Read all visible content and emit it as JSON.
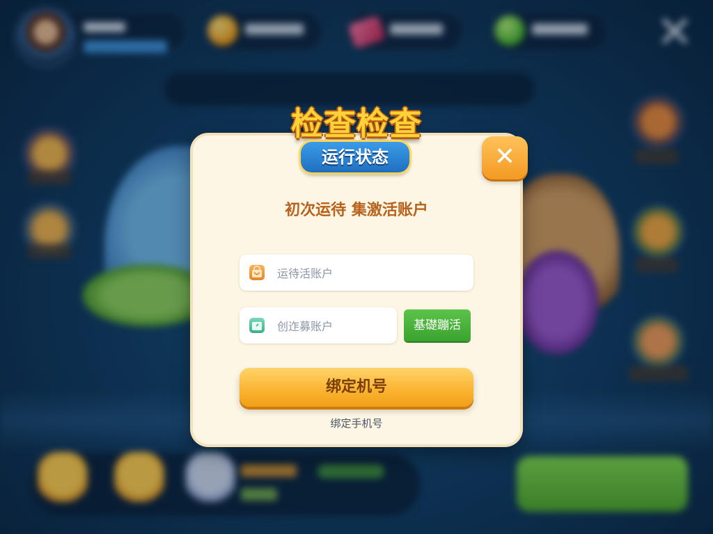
{
  "colors": {
    "primary_button": "#fbb534",
    "activate_button": "#3aa32e",
    "dialog_bg": "#fdf6e4",
    "subtitle_text": "#b8611a",
    "title_gold": "#ffd23a",
    "badge_blue": "#1f6fc0"
  },
  "dialog": {
    "title": "检查检查",
    "badge": "运行状态",
    "close_icon": "✕",
    "subtitle": "初次运待 集激活账户",
    "account_field": {
      "icon": "bag-icon",
      "placeholder": "运待活账户",
      "value": ""
    },
    "code_field": {
      "icon": "wallet-icon",
      "placeholder": "创迮募账户",
      "value": ""
    },
    "activate_label": "基礎蹦活",
    "bind_button_label": "绑定机号",
    "bind_link_label": "绑定手机号"
  }
}
